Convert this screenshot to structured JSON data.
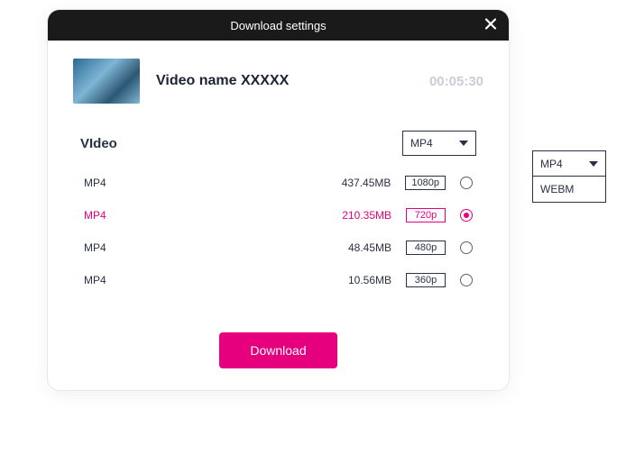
{
  "header": {
    "title": "Download settings"
  },
  "video": {
    "name": "Video name XXXXX",
    "duration": "00:05:30"
  },
  "section": {
    "label": "VIdeo"
  },
  "format_select": {
    "value": "MP4"
  },
  "options": [
    {
      "format": "MP4",
      "size": "437.45MB",
      "resolution": "1080p",
      "selected": false
    },
    {
      "format": "MP4",
      "size": "210.35MB",
      "resolution": "720p",
      "selected": true
    },
    {
      "format": "MP4",
      "size": "48.45MB",
      "resolution": "480p",
      "selected": false
    },
    {
      "format": "MP4",
      "size": "10.56MB",
      "resolution": "360p",
      "selected": false
    }
  ],
  "buttons": {
    "download": "Download"
  },
  "dropdown_open": {
    "selected": "MP4",
    "items": [
      "WEBM"
    ]
  }
}
